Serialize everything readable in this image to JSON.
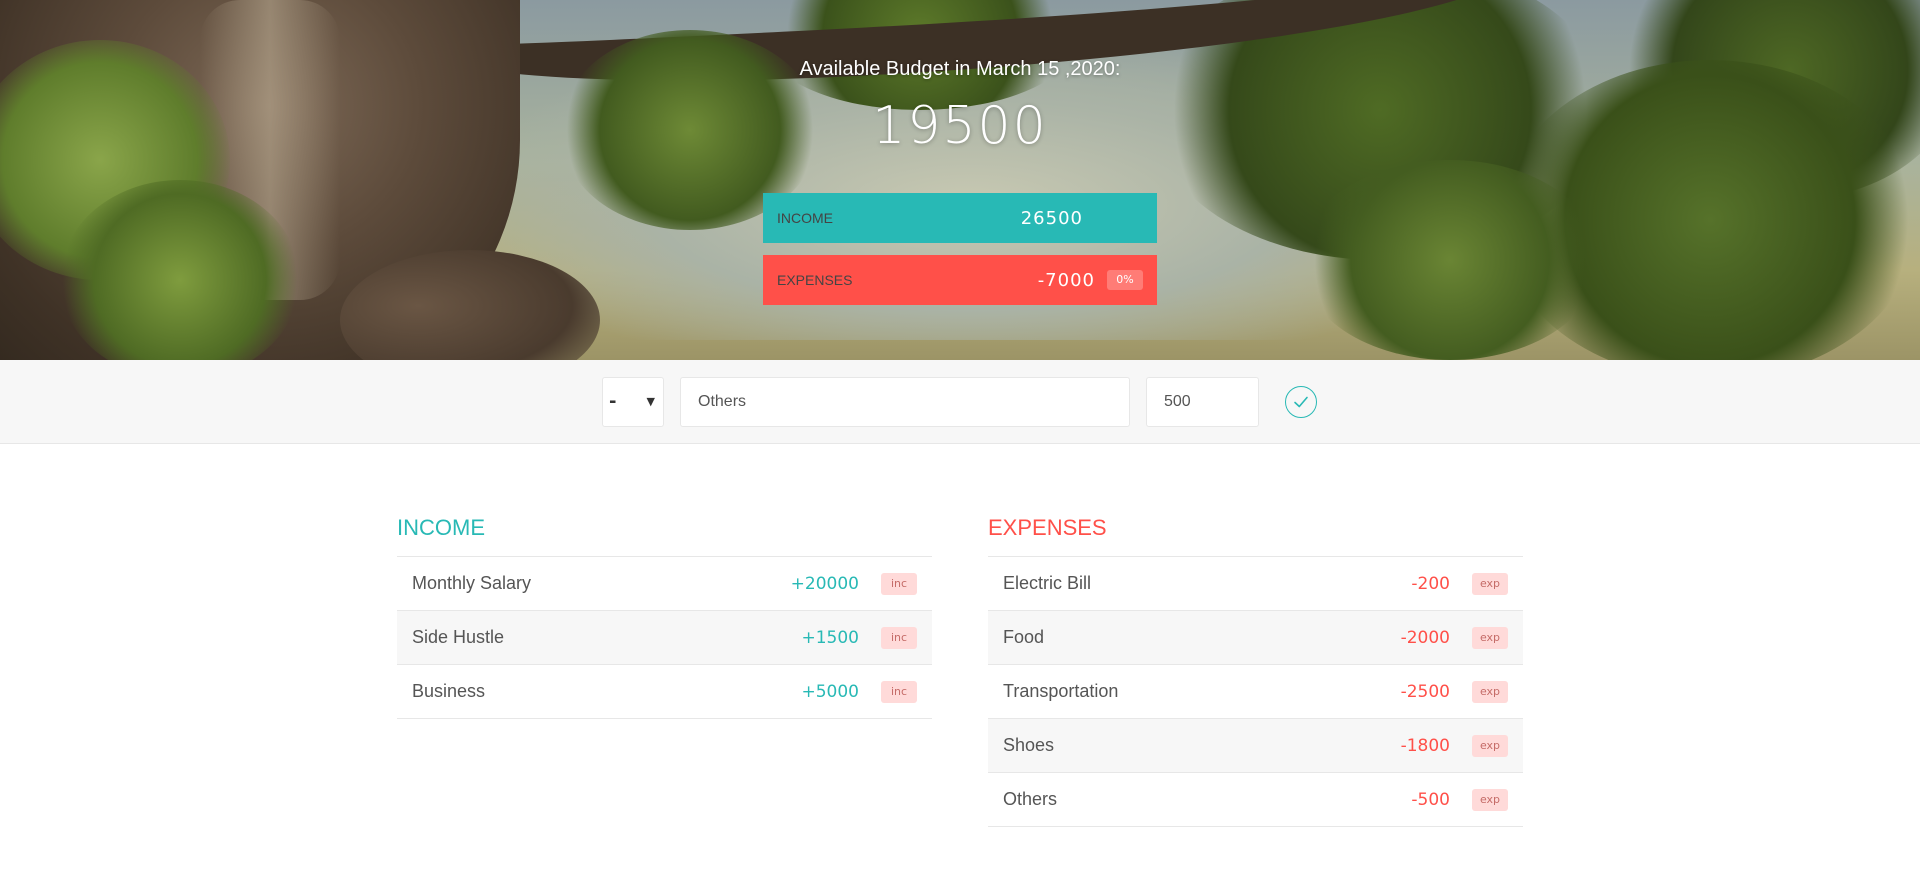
{
  "header": {
    "title": "Available Budget in March 15 ,2020:",
    "budget": "19500",
    "income": {
      "label": "INCOME",
      "value": "26500"
    },
    "expenses": {
      "label": "EXPENSES",
      "value": "-7000",
      "percentage": "0%"
    }
  },
  "add": {
    "type_value": "-",
    "description_value": "Others",
    "amount_value": "500",
    "submit_icon": "checkmark-circle-icon"
  },
  "income": {
    "title": "INCOME",
    "items": [
      {
        "description": "Monthly Salary",
        "value": "+20000",
        "tag": "inc"
      },
      {
        "description": "Side Hustle",
        "value": "+1500",
        "tag": "inc"
      },
      {
        "description": "Business",
        "value": "+5000",
        "tag": "inc"
      }
    ]
  },
  "expenses": {
    "title": "EXPENSES",
    "items": [
      {
        "description": "Electric Bill",
        "value": "-200",
        "tag": "exp"
      },
      {
        "description": "Food",
        "value": "-2000",
        "tag": "exp"
      },
      {
        "description": "Transportation",
        "value": "-2500",
        "tag": "exp"
      },
      {
        "description": "Shoes",
        "value": "-1800",
        "tag": "exp"
      },
      {
        "description": "Others",
        "value": "-500",
        "tag": "exp"
      }
    ]
  },
  "colors": {
    "income": "#28b9b5",
    "expenses": "#ff5049",
    "tag_bg": "#ffdad9"
  }
}
